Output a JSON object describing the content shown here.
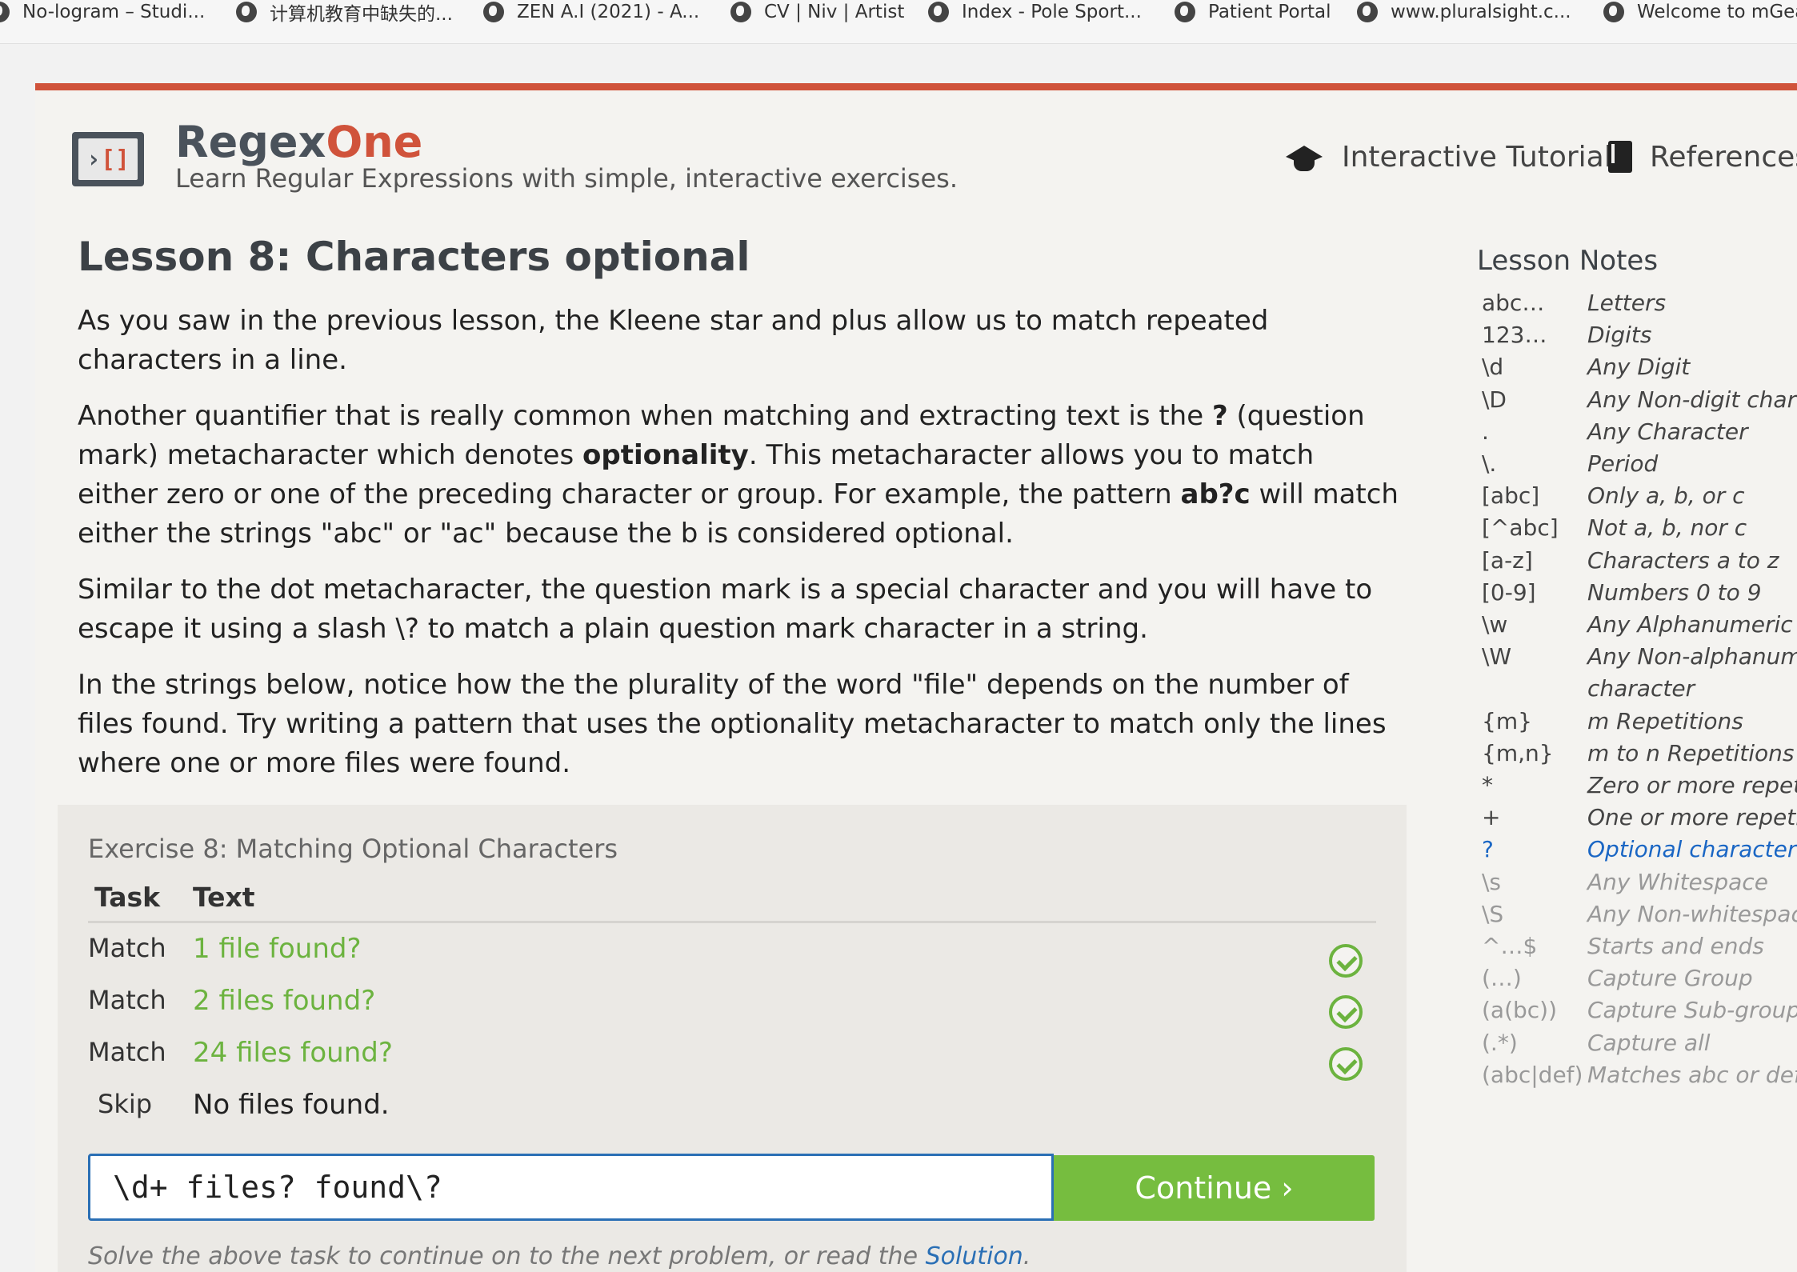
{
  "bookmarks": [
    {
      "label": "No-logram – Studi..."
    },
    {
      "label": "计算机教育中缺失的..."
    },
    {
      "label": "ZEN A.I (2021) - A..."
    },
    {
      "label": "CV | Niv | Artist"
    },
    {
      "label": "Index - Pole Sport..."
    },
    {
      "label": "Patient Portal"
    },
    {
      "label": "www.pluralsight.c..."
    },
    {
      "label": "Welcome to mGea"
    }
  ],
  "header": {
    "brand_main": "Regex",
    "brand_accent": "One",
    "logo_gt": "›",
    "logo_brackets": "[]",
    "tagline": "Learn Regular Expressions with simple, interactive exercises.",
    "nav_tutorial": "Interactive Tutorial",
    "nav_references": "References"
  },
  "lesson": {
    "title": "Lesson 8: Characters optional",
    "p1": "As you saw in the previous lesson, the Kleene star and plus allow us to match repeated characters in a line.",
    "p2_a": "Another quantifier that is really common when matching and extracting text is the ",
    "p2_b": "?",
    "p2_c": " (question mark) metacharacter which denotes ",
    "p2_d": "optionality",
    "p2_e": ". This metacharacter allows you to match either zero or one of the preceding character or group. For example, the pattern ",
    "p2_f": "ab?c",
    "p2_g": " will match either the strings \"abc\" or \"ac\" because the b is considered optional.",
    "p3": "Similar to the dot metacharacter, the question mark is a special character and you will have to escape it using a slash \\? to match a plain question mark character in a string.",
    "p4": "In the strings below, notice how the the plurality of the word \"file\" depends on the number of files found. Try writing a pattern that uses the optionality metacharacter to match only the lines where one or more files were found."
  },
  "exercise": {
    "title": "Exercise 8: Matching Optional Characters",
    "col_task": "Task",
    "col_text": "Text",
    "rows": [
      {
        "task": "Match",
        "text": "1 file found?"
      },
      {
        "task": "Match",
        "text": "2 files found?"
      },
      {
        "task": "Match",
        "text": "24 files found?"
      },
      {
        "task": "Skip",
        "text": "No files found."
      }
    ],
    "input_value": "\\d+ files? found\\?",
    "continue_label": "Continue ›",
    "hint_text": "Solve the above task to continue on to the next problem, or read the ",
    "hint_link": "Solution",
    "hint_end": "."
  },
  "notes": {
    "title": "Lesson Notes",
    "items": [
      {
        "key": "abc…",
        "val": "Letters"
      },
      {
        "key": "123…",
        "val": "Digits"
      },
      {
        "key": "\\d",
        "val": "Any Digit"
      },
      {
        "key": "\\D",
        "val": "Any Non-digit charac"
      },
      {
        "key": ".",
        "val": "Any Character"
      },
      {
        "key": "\\.",
        "val": "Period"
      },
      {
        "key": "[abc]",
        "val": "Only a, b, or c"
      },
      {
        "key": "[^abc]",
        "val": "Not a, b, nor c"
      },
      {
        "key": "[a-z]",
        "val": "Characters a to z"
      },
      {
        "key": "[0-9]",
        "val": "Numbers 0 to 9"
      },
      {
        "key": "\\w",
        "val": "Any Alphanumeric ch"
      },
      {
        "key": "\\W",
        "val": "Any Non-alphanumer"
      },
      {
        "key": "",
        "val": "character"
      },
      {
        "key": "{m}",
        "val": "m Repetitions"
      },
      {
        "key": "{m,n}",
        "val": "m to n Repetitions"
      },
      {
        "key": "*",
        "val": "Zero or more repetit"
      },
      {
        "key": "+",
        "val": "One or more repetiti"
      },
      {
        "key": "?",
        "val": "Optional character"
      },
      {
        "key": "\\s",
        "val": "Any Whitespace"
      },
      {
        "key": "\\S",
        "val": "Any Non-whitespace"
      },
      {
        "key": "^…$",
        "val": "Starts and ends"
      },
      {
        "key": "(…)",
        "val": "Capture Group"
      },
      {
        "key": "(a(bc))",
        "val": "Capture Sub-group"
      },
      {
        "key": "(.*)",
        "val": "Capture all"
      },
      {
        "key": "(abc|def)",
        "val": "Matches abc or def"
      }
    ]
  },
  "colors": {
    "accent_red": "#d0533b",
    "success_green": "#6cb33f",
    "link_blue": "#1a66c4"
  }
}
